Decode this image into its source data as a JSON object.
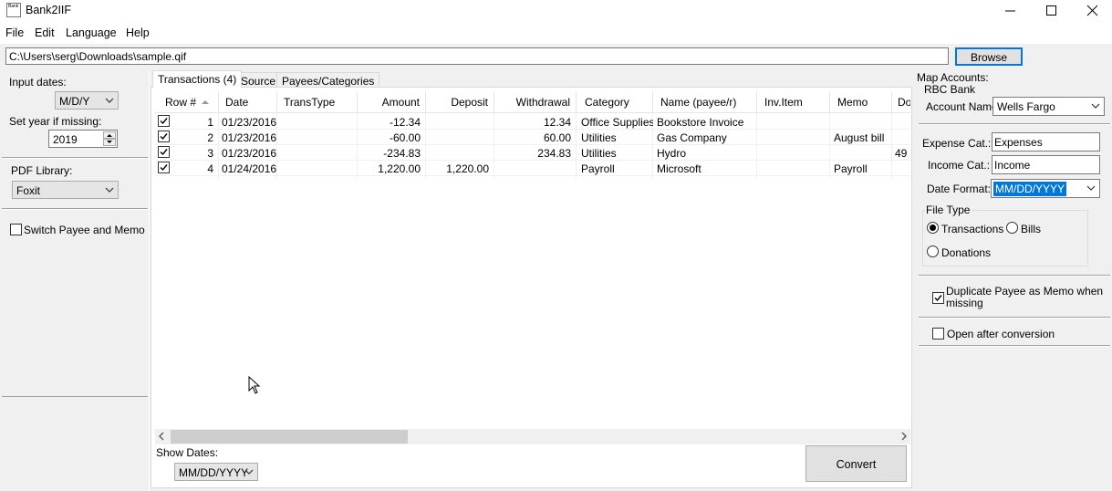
{
  "window": {
    "title": "Bank2IIF",
    "icon_text": "Bank"
  },
  "menu": [
    "File",
    "Edit",
    "Language",
    "Help"
  ],
  "file_path": "C:\\Users\\serg\\Downloads\\sample.qif",
  "browse_label": "Browse",
  "left_panel": {
    "input_dates_label": "Input dates:",
    "input_dates_value": "M/D/Y",
    "set_year_label": "Set year if missing:",
    "year_value": "2019",
    "pdf_library_label": "PDF Library:",
    "pdf_library_value": "Foxit",
    "switch_label": "Switch Payee and Memo",
    "switch_checked": false
  },
  "tabs": [
    "Transactions (4)",
    "Source",
    "Payees/Categories"
  ],
  "table": {
    "columns": [
      "Row #",
      "Date",
      "TransType",
      "Amount",
      "Deposit",
      "Withdrawal",
      "Category",
      "Name (payee/r)",
      "Inv.Item",
      "Memo",
      "Do"
    ],
    "rows": [
      {
        "checked": true,
        "row": "1",
        "date": "01/23/2016",
        "transtype": "",
        "amount": "-12.34",
        "deposit": "",
        "withdrawal": "12.34",
        "category": "Office Supplies",
        "name": "Bookstore Invoice",
        "inv": "",
        "memo": "",
        "doc": ""
      },
      {
        "checked": true,
        "row": "2",
        "date": "01/23/2016",
        "transtype": "",
        "amount": "-60.00",
        "deposit": "",
        "withdrawal": "60.00",
        "category": "Utilities",
        "name": "Gas Company",
        "inv": "",
        "memo": "August bill",
        "doc": ""
      },
      {
        "checked": true,
        "row": "3",
        "date": "01/23/2016",
        "transtype": "",
        "amount": "-234.83",
        "deposit": "",
        "withdrawal": "234.83",
        "category": "Utilities",
        "name": "Hydro",
        "inv": "",
        "memo": "",
        "doc": "49"
      },
      {
        "checked": true,
        "row": "4",
        "date": "01/24/2016",
        "transtype": "",
        "amount": "1,220.00",
        "deposit": "1,220.00",
        "withdrawal": "",
        "category": "Payroll",
        "name": "Microsoft",
        "inv": "",
        "memo": "Payroll",
        "doc": ""
      }
    ]
  },
  "show_dates_label": "Show Dates:",
  "show_dates_value": "MM/DD/YYYY",
  "convert_label": "Convert",
  "right_panel": {
    "map_accounts_label": "Map Accounts:",
    "bank_name": "RBC Bank",
    "account_name_label": "Account Name:",
    "account_name_value": "Wells Fargo",
    "expense_cat_label": "Expense Cat.:",
    "expense_cat_value": "Expenses",
    "income_cat_label": "Income Cat.:",
    "income_cat_value": "Income",
    "date_format_label": "Date Format:",
    "date_format_value": "MM/DD/YYYY",
    "file_type_label": "File Type",
    "file_type_options": [
      "Transactions",
      "Bills",
      "Donations"
    ],
    "file_type_selected": "Transactions",
    "duplicate_label": "Duplicate Payee as Memo when missing",
    "duplicate_line1": "Duplicate Payee as Memo when",
    "duplicate_line2": "missing",
    "duplicate_checked": true,
    "open_after_label": "Open after conversion",
    "open_after_checked": false
  },
  "colors": {
    "selection": "#0078d7",
    "accent_border": "#0078d7"
  }
}
